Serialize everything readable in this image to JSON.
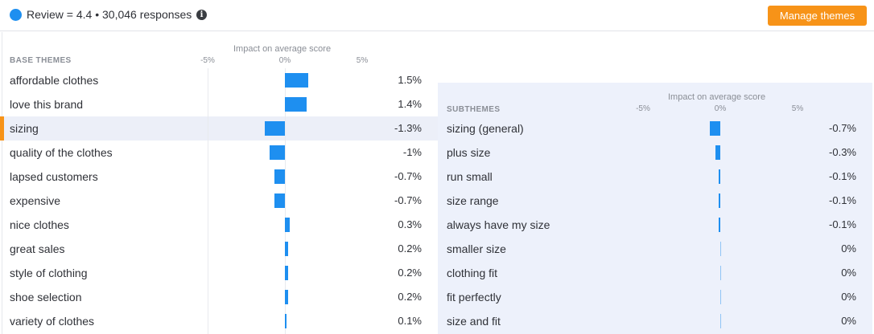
{
  "header": {
    "review_summary": "Review = 4.4 • 30,046 responses",
    "info_icon": "info-icon",
    "manage_button": "Manage themes",
    "accent_color": "#1e8ff0",
    "button_color": "#f79318"
  },
  "chart_data": [
    {
      "type": "bar",
      "orientation": "horizontal",
      "section_label": "BASE THEMES",
      "title": "Impact on average score",
      "ticks": [
        "-5%",
        "0%",
        "5%"
      ],
      "xlim": [
        -5,
        5
      ],
      "categories": [
        "affordable clothes",
        "love this brand",
        "sizing",
        "quality of the clothes",
        "lapsed customers",
        "expensive",
        "nice clothes",
        "great sales",
        "style of clothing",
        "shoe selection",
        "variety of clothes"
      ],
      "values": [
        1.5,
        1.4,
        -1.3,
        -1,
        -0.7,
        -0.7,
        0.3,
        0.2,
        0.2,
        0.2,
        0.1
      ],
      "value_labels": [
        "1.5%",
        "1.4%",
        "-1.3%",
        "-1%",
        "-0.7%",
        "-0.7%",
        "0.3%",
        "0.2%",
        "0.2%",
        "0.2%",
        "0.1%"
      ],
      "selected": "sizing"
    },
    {
      "type": "bar",
      "orientation": "horizontal",
      "section_label": "SUBTHEMES",
      "title": "Impact on average score",
      "ticks": [
        "-5%",
        "0%",
        "5%"
      ],
      "xlim": [
        -5,
        5
      ],
      "categories": [
        "sizing (general)",
        "plus size",
        "run small",
        "size range",
        "always have my size",
        "smaller size",
        "clothing fit",
        "fit perfectly",
        "size and fit"
      ],
      "values": [
        -0.7,
        -0.3,
        -0.1,
        -0.1,
        -0.1,
        0,
        0,
        0,
        0
      ],
      "value_labels": [
        "-0.7%",
        "-0.3%",
        "-0.1%",
        "-0.1%",
        "-0.1%",
        "0%",
        "0%",
        "0%",
        "0%"
      ]
    }
  ]
}
